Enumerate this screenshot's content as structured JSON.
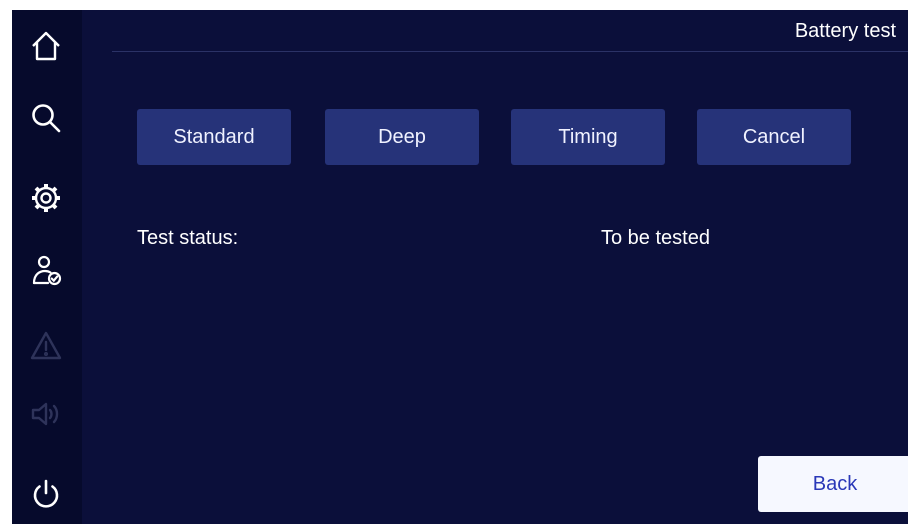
{
  "header": {
    "title": "Battery test"
  },
  "sidebar": {
    "items": [
      {
        "icon": "home-icon",
        "enabled": true
      },
      {
        "icon": "search-icon",
        "enabled": true
      },
      {
        "icon": "gear-icon",
        "enabled": true
      },
      {
        "icon": "user-check-icon",
        "enabled": true
      },
      {
        "icon": "warning-icon",
        "enabled": false
      },
      {
        "icon": "speaker-icon",
        "enabled": false
      },
      {
        "icon": "power-icon",
        "enabled": true
      }
    ]
  },
  "test_buttons": {
    "standard": "Standard",
    "deep": "Deep",
    "timing": "Timing",
    "cancel": "Cancel"
  },
  "status": {
    "label": "Test status:",
    "value": "To be tested"
  },
  "footer": {
    "back_label": "Back"
  },
  "colors": {
    "background": "#0b0f3a",
    "sidebar": "#060a2c",
    "button": "#263379",
    "back_button": "#f6f8ff",
    "back_text": "#2a38b8",
    "disabled_icon": "#2e335a"
  }
}
